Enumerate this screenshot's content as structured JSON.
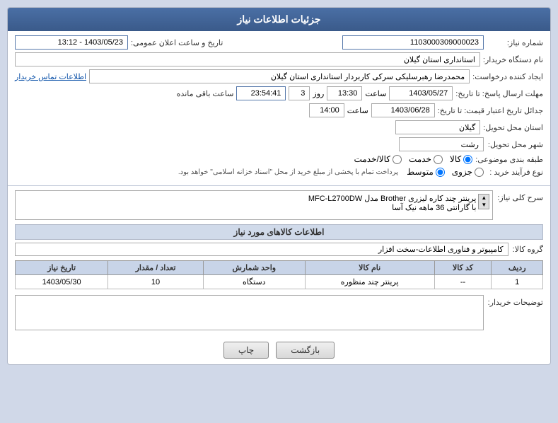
{
  "header": {
    "title": "جزئیات اطلاعات نیاز"
  },
  "fields": {
    "shomareNiaz_label": "شماره نیاز:",
    "shomareNiaz_value": "1103000309000023",
    "namDastgah_label": "نام دستگاه خریدار:",
    "namDastgah_value": "استانداری استان گیلان",
    "ijadKonande_label": "ایجاد کننده درخواست:",
    "ijadKonande_value": "محمدرضا رهبرسلیکی سرکی کاربردار استانداری استان گیلان",
    "etelaatTamas_link": "اطلاعات تماس خریدار",
    "mohlat_label": "مهلت ارسال پاسخ: تا تاریخ:",
    "mohlat_date": "1403/05/27",
    "mohlat_time": "13:30",
    "mohlat_day": "3",
    "mohlat_remaining": "23:54:41",
    "mohlat_remaining_label": "ساعت باقی مانده",
    "jadaval_label": "جدائل تاریخ اعتبار قیمت: تا تاریخ:",
    "jadaval_date": "1403/06/28",
    "jadaval_time": "14:00",
    "ostan_label": "استان محل تحویل:",
    "ostan_value": "گیلان",
    "shahr_label": "شهر محل تحویل:",
    "shahr_value": "رشت",
    "tabaghe_label": "طبقه بندی موضوعی:",
    "tabaghe_kala": "کالا",
    "tabaghe_khedmat": "خدمت",
    "tabaghe_kalaKhedmat": "کالا/خدمت",
    "noeFarayand_label": "نوع فرآیند خرید :",
    "noeFarayand_jozvi": "جزوی",
    "noeFarayand_motevaset": "متوسط",
    "noeFarayand_note": "پرداخت تمام با پخشی از مبلغ خرید از محل \"اسناد خزانه اسلامی\" خواهد بود.",
    "tarikhVaSaat_label": "تاریخ و ساعت اعلان عمومی:",
    "tarikhVaSaat_value": "1403/05/23 - 13:12",
    "serh_label": "سرح کلی نیاز:",
    "serh_value": "پرینتر چند کاره لیزری Brother مدل MFC-L2700DW\nبا گارانتی 36 ماهه نیک آسا",
    "etelaatKalaSection": "اطلاعات کالاهای مورد نیاز",
    "groupKala_label": "گروه کالا:",
    "groupKala_value": "کامپیوتر و فناوری اطلاعات-سخت افزار",
    "table": {
      "headers": [
        "ردیف",
        "کد کالا",
        "نام کالا",
        "واحد شمارش",
        "تعداد / مقدار",
        "تاریخ نیاز"
      ],
      "rows": [
        [
          "1",
          "--",
          "پرینتر چند منظوره",
          "دستگاه",
          "10",
          "1403/05/30"
        ]
      ]
    },
    "tozih_label": "توضیحات خریدار:",
    "tozih_value": "",
    "btn_chap": "چاپ",
    "btn_bazgasht": "بازگشت"
  }
}
